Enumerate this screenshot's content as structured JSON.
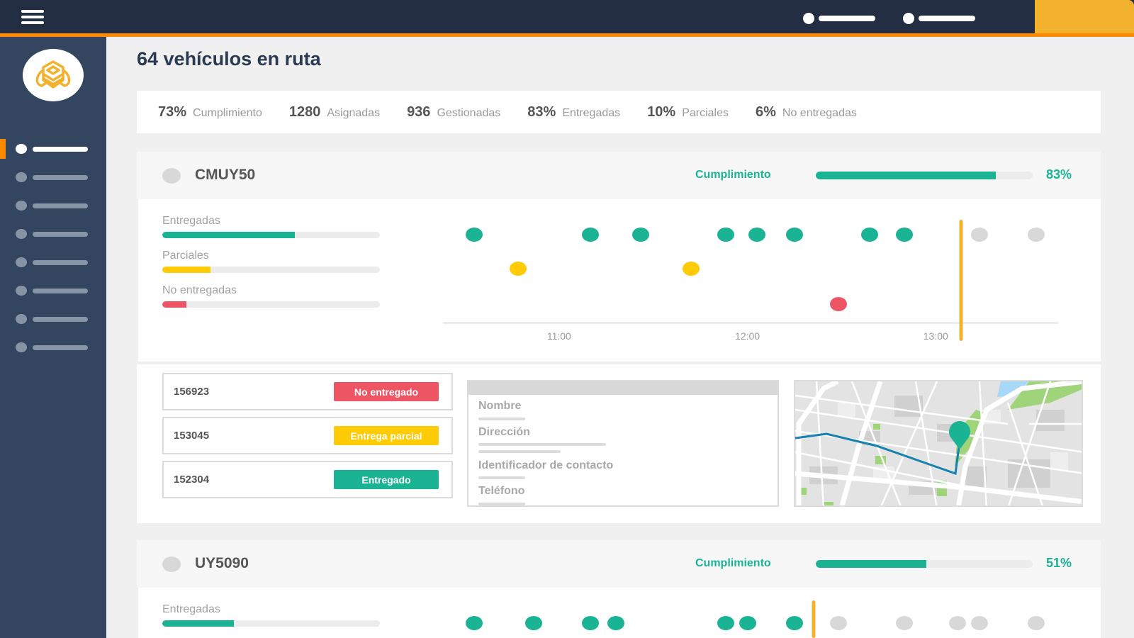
{
  "topbar": {
    "menu_icon": "hamburger-menu-icon",
    "nav_items": [
      {
        "icon": "placeholder-dot"
      },
      {
        "icon": "placeholder-dot"
      }
    ],
    "colors": {
      "bar": "#242e42",
      "accent": "#ff8a00",
      "corner": "#f2b22e"
    }
  },
  "sidebar": {
    "logo_icon": "bee-logo-icon",
    "items": [
      {
        "active": true
      },
      {
        "active": false
      },
      {
        "active": false
      },
      {
        "active": false
      },
      {
        "active": false
      },
      {
        "active": false
      },
      {
        "active": false
      },
      {
        "active": false
      }
    ]
  },
  "page": {
    "title": "64 vehículos en ruta"
  },
  "stats": [
    {
      "value": "73%",
      "label": "Cumplimiento"
    },
    {
      "value": "1280",
      "label": "Asignadas"
    },
    {
      "value": "936",
      "label": "Gestionadas"
    },
    {
      "value": "83%",
      "label": "Entregadas"
    },
    {
      "value": "10%",
      "label": "Parciales"
    },
    {
      "value": "6%",
      "label": "No entregadas"
    }
  ],
  "colors": {
    "delivered": "#1ab394",
    "partial": "#ffcb05",
    "failed": "#ed5565",
    "pending": "#d8d8d8",
    "now": "#f2b22e"
  },
  "timeline_axis": {
    "start": "10:23",
    "end": "13:39",
    "ticks": [
      "11:00",
      "12:00",
      "13:00"
    ]
  },
  "vehicles": [
    {
      "plate": "CMUY50",
      "compliance_label": "Cumplimiento",
      "compliance_pct": 83,
      "compliance_text": "83%",
      "breakdown": [
        {
          "label": "Entregadas",
          "fraction": 0.61,
          "status": "delivered"
        },
        {
          "label": "Parciales",
          "fraction": 0.22,
          "status": "partial"
        },
        {
          "label": "No entregadas",
          "fraction": 0.11,
          "status": "failed"
        }
      ],
      "now": "13:08",
      "events": [
        {
          "time": "10:33",
          "status": "delivered"
        },
        {
          "time": "11:10",
          "status": "delivered"
        },
        {
          "time": "11:26",
          "status": "delivered"
        },
        {
          "time": "11:53",
          "status": "delivered"
        },
        {
          "time": "12:03",
          "status": "delivered"
        },
        {
          "time": "12:15",
          "status": "delivered"
        },
        {
          "time": "12:39",
          "status": "delivered"
        },
        {
          "time": "12:50",
          "status": "delivered"
        },
        {
          "time": "13:14",
          "status": "pending"
        },
        {
          "time": "13:32",
          "status": "pending"
        },
        {
          "time": "10:47",
          "status": "partial"
        },
        {
          "time": "11:42",
          "status": "partial"
        },
        {
          "time": "12:29",
          "status": "failed"
        }
      ],
      "orders": [
        {
          "id": "156923",
          "status_label": "No entregado",
          "status": "failed"
        },
        {
          "id": "153045",
          "status_label": "Entrega parcial",
          "status": "partial"
        },
        {
          "id": "152304",
          "status_label": "Entregado",
          "status": "delivered"
        }
      ],
      "contact_fields": [
        "Nombre",
        "Dirección",
        "Identificador de contacto",
        "Teléfono"
      ],
      "map": {
        "marker_icon": "map-pin-icon",
        "route_color": "#1582b0"
      }
    },
    {
      "plate": "UY5090",
      "compliance_label": "Cumplimiento",
      "compliance_pct": 51,
      "compliance_text": "51%",
      "breakdown": [
        {
          "label": "Entregadas",
          "fraction": 0.33,
          "status": "delivered"
        }
      ],
      "now": "12:21",
      "events": [
        {
          "time": "10:33",
          "status": "delivered"
        },
        {
          "time": "10:52",
          "status": "delivered"
        },
        {
          "time": "11:10",
          "status": "delivered"
        },
        {
          "time": "11:18",
          "status": "delivered"
        },
        {
          "time": "11:53",
          "status": "delivered"
        },
        {
          "time": "12:00",
          "status": "delivered"
        },
        {
          "time": "12:15",
          "status": "delivered"
        },
        {
          "time": "12:29",
          "status": "pending"
        },
        {
          "time": "12:50",
          "status": "pending"
        },
        {
          "time": "13:07",
          "status": "pending"
        },
        {
          "time": "13:14",
          "status": "pending"
        },
        {
          "time": "13:32",
          "status": "pending"
        }
      ]
    }
  ]
}
